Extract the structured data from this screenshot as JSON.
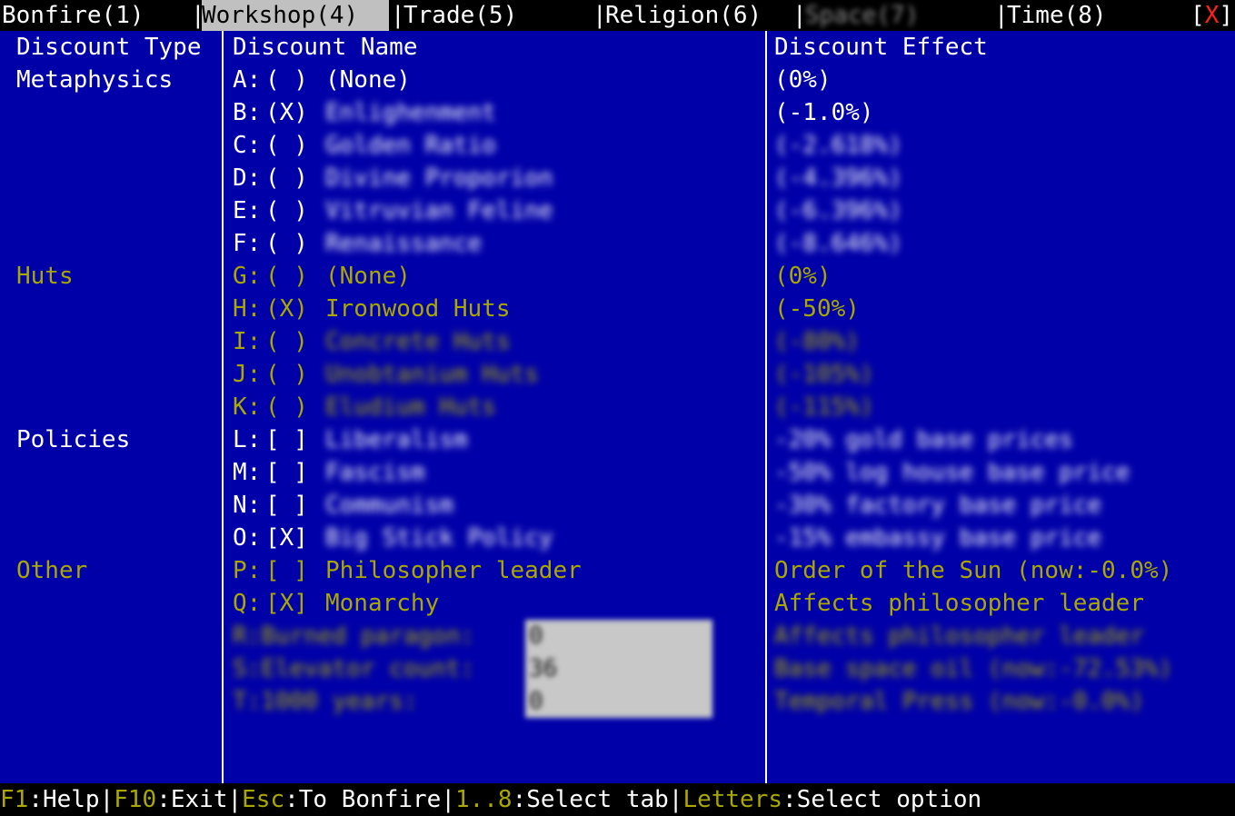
{
  "tabs": [
    {
      "label": "Bonfire(1)"
    },
    {
      "label": "Workshop(4)"
    },
    {
      "label": "Trade(5)"
    },
    {
      "label": "Religion(6)"
    },
    {
      "label": "Space(7)"
    },
    {
      "label": "Time(8)"
    }
  ],
  "close": {
    "label": "X"
  },
  "headers": {
    "type": "Discount Type",
    "name": "Discount Name",
    "effect": "Discount Effect"
  },
  "rows": [
    {
      "type": "Metaphysics",
      "key": "A:",
      "mark": "( )",
      "name": "(None)",
      "effect": "(0%)"
    },
    {
      "type": "",
      "key": "B:",
      "mark": "(X)",
      "name": "Enlighenment",
      "effect": "(-1.0%)"
    },
    {
      "type": "",
      "key": "C:",
      "mark": "( )",
      "name": "Golden Ratio",
      "effect": "(-2.618%)"
    },
    {
      "type": "",
      "key": "D:",
      "mark": "( )",
      "name": "Divine Proporion",
      "effect": "(-4.396%)"
    },
    {
      "type": "",
      "key": "E:",
      "mark": "( )",
      "name": "Vitruvian Feline",
      "effect": "(-6.396%)"
    },
    {
      "type": "",
      "key": "F:",
      "mark": "( )",
      "name": "Renaissance",
      "effect": "(-8.646%)"
    },
    {
      "type": "Huts",
      "key": "G:",
      "mark": "( )",
      "name": "(None)",
      "effect": "(0%)"
    },
    {
      "type": "",
      "key": "H:",
      "mark": "(X)",
      "name": "Ironwood Huts",
      "effect": "(-50%)"
    },
    {
      "type": "",
      "key": "I:",
      "mark": "( )",
      "name": "Concrete Huts",
      "effect": "(-80%)"
    },
    {
      "type": "",
      "key": "J:",
      "mark": "( )",
      "name": "Unobtanium Huts",
      "effect": "(-105%)"
    },
    {
      "type": "",
      "key": "K:",
      "mark": "( )",
      "name": "Eludium Huts",
      "effect": "(-115%)"
    },
    {
      "type": "Policies",
      "key": "L:",
      "mark": "[ ]",
      "name": "Liberalism",
      "effect": "-20% gold base prices"
    },
    {
      "type": "",
      "key": "M:",
      "mark": "[ ]",
      "name": "Fascism",
      "effect": "-50% log house base price"
    },
    {
      "type": "",
      "key": "N:",
      "mark": "[ ]",
      "name": "Communism",
      "effect": "-30% factory base price"
    },
    {
      "type": "",
      "key": "O:",
      "mark": "[X]",
      "name": "Big Stick Policy",
      "effect": "-15% embassy base price"
    },
    {
      "type": "Other",
      "key": "P:",
      "mark": "[ ]",
      "name": "Philosopher leader",
      "effect": "Order of the Sun (now:-0.0%)"
    },
    {
      "type": "",
      "key": "Q:",
      "mark": "[X]",
      "name": "Monarchy",
      "effect": "Affects philosopher leader"
    }
  ],
  "inputs": [
    {
      "label": "R:Burned paragon:",
      "value": "0",
      "effect": "Affects philosopher leader"
    },
    {
      "label": "S:Elevator count:",
      "value": "36",
      "effect": "Base space oil (now:-72.53%)"
    },
    {
      "label": "T:1000 years:",
      "value": "0",
      "effect": "Temporal Press (now:-0.0%)"
    }
  ],
  "statusbar": [
    {
      "key": "F1",
      "desc": ":Help"
    },
    {
      "key": "F10",
      "desc": ":Exit"
    },
    {
      "key": "Esc",
      "desc": ":To Bonfire"
    },
    {
      "key": "1..8",
      "desc": ":Select tab"
    },
    {
      "key": "Letters",
      "desc": ":Select option"
    }
  ],
  "colors": {
    "background": "#0000a8",
    "text": "#ffffff",
    "accent": "#a8a800",
    "close": "#ff2020",
    "active_tab": "#c0c0c0"
  }
}
